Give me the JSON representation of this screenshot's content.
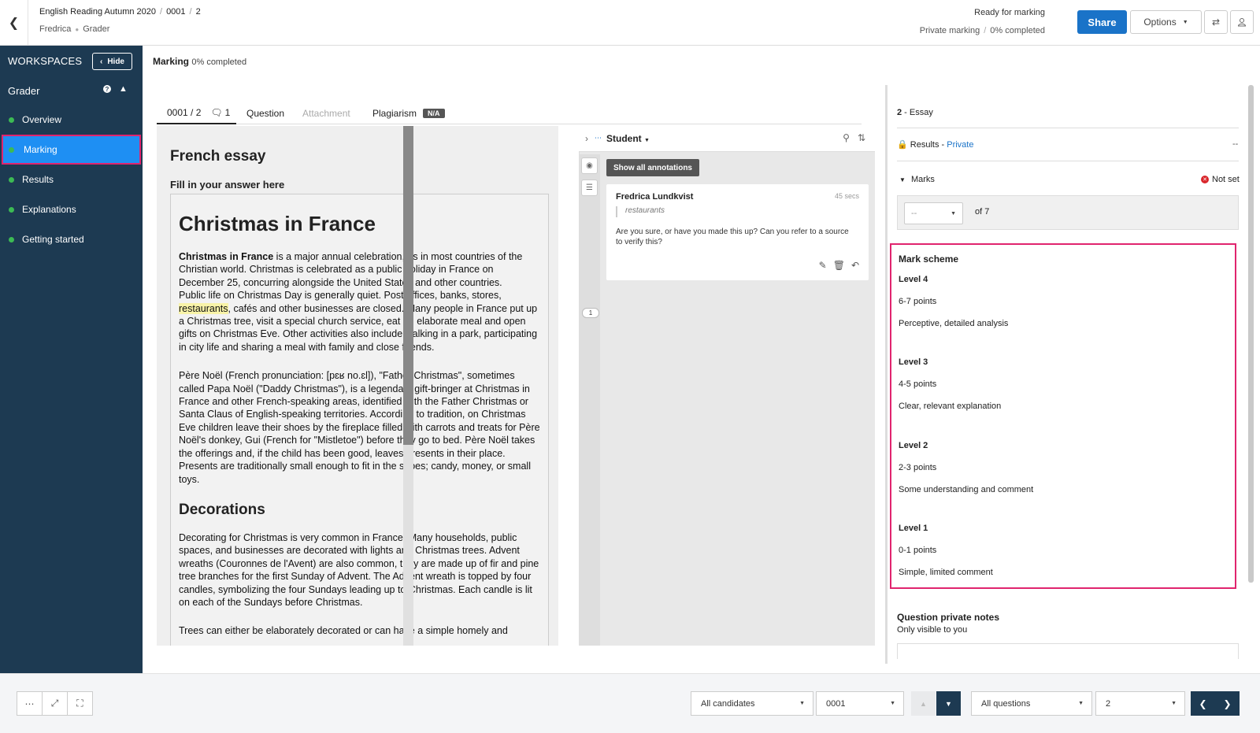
{
  "header": {
    "breadcrumb": [
      "English Reading Autumn 2020",
      "0001",
      "2"
    ],
    "subcrumbs": [
      "Fredrica",
      "Grader"
    ],
    "status_title": "Ready for marking",
    "status_mode": "Private marking",
    "status_progress": "0% completed",
    "share_label": "Share",
    "options_label": "Options",
    "icons": [
      "back-icon",
      "swap-icon",
      "user-icon"
    ]
  },
  "sidebar": {
    "workspaces_label": "WORKSPACES",
    "hide_label": "Hide",
    "section_title": "Grader",
    "items": [
      {
        "label": "Overview"
      },
      {
        "label": "Marking",
        "active": true
      },
      {
        "label": "Results"
      },
      {
        "label": "Explanations"
      },
      {
        "label": "Getting started"
      }
    ],
    "colors": {
      "background": "#1d3a52",
      "active": "#1e8ff3",
      "dot": "#3cba54",
      "highlight": "#e0246e"
    }
  },
  "main": {
    "marking_label": "Marking",
    "marking_progress": "0% completed",
    "tabs": {
      "candidate": "0001 / 2",
      "comments_count": "1",
      "question": "Question",
      "attachment": "Attachment",
      "plagiarism": "Plagiarism",
      "plagiarism_badge": "N/A"
    }
  },
  "document": {
    "title": "French essay",
    "prompt": "Fill in your answer here",
    "heading1": "Christmas in France",
    "p1_bold": "Christmas in France",
    "p1_rest": " is a major annual celebration, as in most countries of the Christian world. Christmas is celebrated as a public holiday in France on December 25, concurring alongside the United States and other countries.",
    "p2_start": "Public life on Christmas Day is generally quiet. Post offices, banks, stores, ",
    "p2_highlight": "restaurants",
    "p2_end": ", cafés and other businesses are closed. Many people in France put up a Christmas tree, visit a special church service, eat an elaborate meal and open gifts on Christmas Eve. Other activities also include walking in a park, participating in city life and sharing a meal with family and close friends.",
    "p3": "Père Noël (French pronunciation: [pɛʁ no.ɛl]), \"Father Christmas\", sometimes called Papa Noël (\"Daddy Christmas\"), is a legendary gift-bringer at Christmas in France and other French-speaking areas, identified with the Father Christmas or Santa Claus of English-speaking territories. According to tradition, on Christmas Eve children leave their shoes by the fireplace filled with carrots and treats for Père Noël's donkey, Gui (French for \"Mistletoe\") before they go to bed. Père Noël takes the offerings and, if the child has been good, leaves presents in their place. Presents are traditionally small enough to fit in the shoes; candy, money, or small toys.",
    "heading2": "Decorations",
    "p4": "Decorating for Christmas is very common in France. Many households, public spaces, and businesses are decorated with lights and Christmas trees. Advent wreaths (Couronnes de l'Avent) are also common, they are made up of fir and pine tree branches for the first Sunday of Advent. The Advent wreath is topped by four candles, symbolizing the four Sundays leading up to Christmas. Each candle is lit on each of the Sundays before Christmas.",
    "p5": "Trees can either be elaborately decorated or can have a simple homely and"
  },
  "annotations": {
    "student_label": "Student",
    "show_all_label": "Show all annotations",
    "marker_number": "1",
    "comment": {
      "author": "Fredrica Lundkvist",
      "time": "45 secs",
      "quote": "restaurants",
      "text": "Are you sure, or have you made this up? Can you refer to a source to verify this?"
    }
  },
  "right_panel": {
    "question_number": "2",
    "question_type": "Essay",
    "results_label": "Results",
    "results_visibility": "Private",
    "results_value": "--",
    "marks_label": "Marks",
    "marks_status": "Not set",
    "marks_select_value": "--",
    "marks_of": "of 7",
    "mark_scheme": {
      "title": "Mark scheme",
      "levels": [
        {
          "level": "Level 4",
          "points": "6-7 points",
          "desc": "Perceptive, detailed analysis"
        },
        {
          "level": "Level 3",
          "points": "4-5 points",
          "desc": "Clear, relevant explanation"
        },
        {
          "level": "Level 2",
          "points": "2-3 points",
          "desc": "Some understanding and comment"
        },
        {
          "level": "Level 1",
          "points": "0-1 points",
          "desc": "Simple, limited comment"
        }
      ]
    },
    "notes_title": "Question private notes",
    "notes_sub": "Only visible to you"
  },
  "bottombar": {
    "candidates_filter": "All candidates",
    "candidate_value": "0001",
    "questions_filter": "All questions",
    "question_value": "2"
  }
}
